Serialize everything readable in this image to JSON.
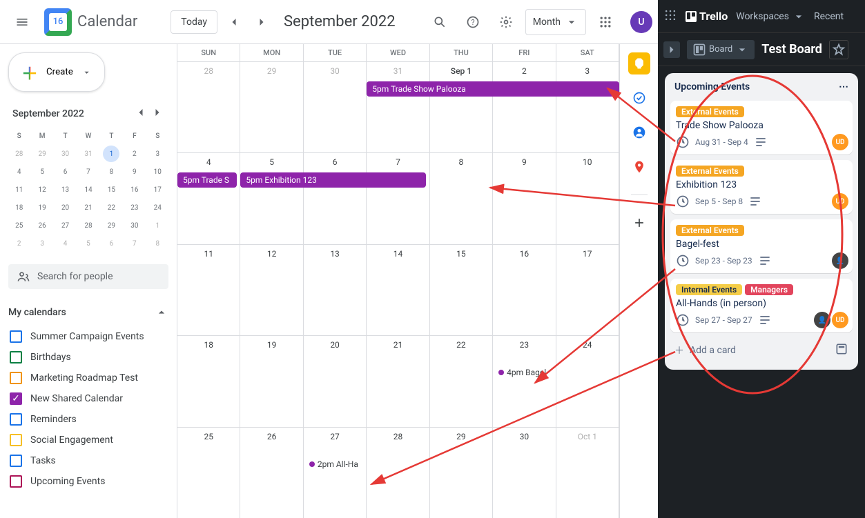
{
  "header": {
    "logo_text": "Calendar",
    "today": "Today",
    "title": "September 2022",
    "view": "Month",
    "avatar": "U"
  },
  "sidebar": {
    "create": "Create",
    "mini_title": "September 2022",
    "dow": [
      "S",
      "M",
      "T",
      "W",
      "T",
      "F",
      "S"
    ],
    "mini_days": [
      {
        "n": "28",
        "dim": true
      },
      {
        "n": "29",
        "dim": true
      },
      {
        "n": "30",
        "dim": true
      },
      {
        "n": "31",
        "dim": true
      },
      {
        "n": "1",
        "cur": true
      },
      {
        "n": "2"
      },
      {
        "n": "3"
      },
      {
        "n": "4"
      },
      {
        "n": "5"
      },
      {
        "n": "6"
      },
      {
        "n": "7"
      },
      {
        "n": "8"
      },
      {
        "n": "9"
      },
      {
        "n": "10"
      },
      {
        "n": "11"
      },
      {
        "n": "12"
      },
      {
        "n": "13"
      },
      {
        "n": "14"
      },
      {
        "n": "15"
      },
      {
        "n": "16"
      },
      {
        "n": "17"
      },
      {
        "n": "18"
      },
      {
        "n": "19"
      },
      {
        "n": "20"
      },
      {
        "n": "21"
      },
      {
        "n": "22"
      },
      {
        "n": "23"
      },
      {
        "n": "24"
      },
      {
        "n": "25"
      },
      {
        "n": "26"
      },
      {
        "n": "27"
      },
      {
        "n": "28"
      },
      {
        "n": "29"
      },
      {
        "n": "30"
      },
      {
        "n": "1",
        "dim": true
      },
      {
        "n": "2",
        "dim": true
      },
      {
        "n": "3",
        "dim": true
      },
      {
        "n": "4",
        "dim": true
      },
      {
        "n": "5",
        "dim": true
      },
      {
        "n": "6",
        "dim": true
      },
      {
        "n": "7",
        "dim": true
      },
      {
        "n": "8",
        "dim": true
      }
    ],
    "search_placeholder": "Search for people",
    "section": "My calendars",
    "cals": [
      {
        "label": "Summer Campaign Events",
        "color": "#1a73e8",
        "checked": false
      },
      {
        "label": "Birthdays",
        "color": "#0b8043",
        "checked": false
      },
      {
        "label": "Marketing Roadmap Test",
        "color": "#f09300",
        "checked": false
      },
      {
        "label": "New Shared Calendar",
        "color": "#8e24aa",
        "checked": true
      },
      {
        "label": "Reminders",
        "color": "#1a73e8",
        "checked": false
      },
      {
        "label": "Social Engagement",
        "color": "#f6bf26",
        "checked": false
      },
      {
        "label": "Tasks",
        "color": "#1a73e8",
        "checked": false
      },
      {
        "label": "Upcoming Events",
        "color": "#ad1457",
        "checked": false
      }
    ]
  },
  "grid": {
    "dow": [
      "SUN",
      "MON",
      "TUE",
      "WED",
      "THU",
      "FRI",
      "SAT"
    ],
    "weeks": [
      [
        {
          "n": "28",
          "dim": true
        },
        {
          "n": "29",
          "dim": true
        },
        {
          "n": "30",
          "dim": true
        },
        {
          "n": "31",
          "dim": true
        },
        {
          "n": "Sep 1",
          "strong": true
        },
        {
          "n": "2"
        },
        {
          "n": "3"
        }
      ],
      [
        {
          "n": "4"
        },
        {
          "n": "5"
        },
        {
          "n": "6"
        },
        {
          "n": "7"
        },
        {
          "n": "8"
        },
        {
          "n": "9"
        },
        {
          "n": "10"
        }
      ],
      [
        {
          "n": "11"
        },
        {
          "n": "12"
        },
        {
          "n": "13"
        },
        {
          "n": "14"
        },
        {
          "n": "15"
        },
        {
          "n": "16"
        },
        {
          "n": "17"
        }
      ],
      [
        {
          "n": "18"
        },
        {
          "n": "19"
        },
        {
          "n": "20"
        },
        {
          "n": "21"
        },
        {
          "n": "22"
        },
        {
          "n": "23"
        },
        {
          "n": "24"
        }
      ],
      [
        {
          "n": "25"
        },
        {
          "n": "26"
        },
        {
          "n": "27"
        },
        {
          "n": "28"
        },
        {
          "n": "29"
        },
        {
          "n": "30"
        },
        {
          "n": "Oct 1",
          "dim": true
        }
      ]
    ],
    "events": {
      "w0_bar": {
        "text": "5pm Trade Show Palooza",
        "left": "42.86%",
        "right": "0%"
      },
      "w1_bar1": {
        "text": "5pm Trade S",
        "left": "0%",
        "width": "13.5%"
      },
      "w1_bar2": {
        "text": "5pm Exhibition 123",
        "left": "14.28%",
        "width": "42%"
      },
      "w3_dot": {
        "text": "4pm Bagel",
        "col": 5
      },
      "w4_dot": {
        "text": "2pm All-Ha",
        "col": 2
      }
    }
  },
  "trello": {
    "logo": "Trello",
    "workspaces": "Workspaces",
    "recent": "Recent",
    "board_btn": "Board",
    "board_name": "Test Board",
    "list_title": "Upcoming Events",
    "cards": [
      {
        "labels": [
          {
            "text": "External Events",
            "color": "#f5a623"
          }
        ],
        "title": "Trade Show Palooza",
        "date": "Aug 31 - Sep 4",
        "avatar": "UD",
        "avclass": "ud"
      },
      {
        "labels": [
          {
            "text": "External Events",
            "color": "#f5a623"
          }
        ],
        "title": "Exhibition 123",
        "date": "Sep 5 - Sep 8",
        "avatar": "UD",
        "avclass": "ud"
      },
      {
        "labels": [
          {
            "text": "External Events",
            "color": "#f5a623"
          }
        ],
        "title": "Bagel-fest",
        "date": "Sep 23 - Sep 23",
        "avatar": "",
        "avclass": "pic"
      },
      {
        "labels": [
          {
            "text": "Internal Events",
            "color": "#f5cd47",
            "tcolor": "#172b4d"
          },
          {
            "text": "Managers",
            "color": "#e2445c"
          }
        ],
        "title": "All-Hands (in person)",
        "date": "Sep 27 - Sep 27",
        "avatar": "UD",
        "avclass": "ud",
        "double": true
      }
    ],
    "add_card": "Add a card"
  }
}
